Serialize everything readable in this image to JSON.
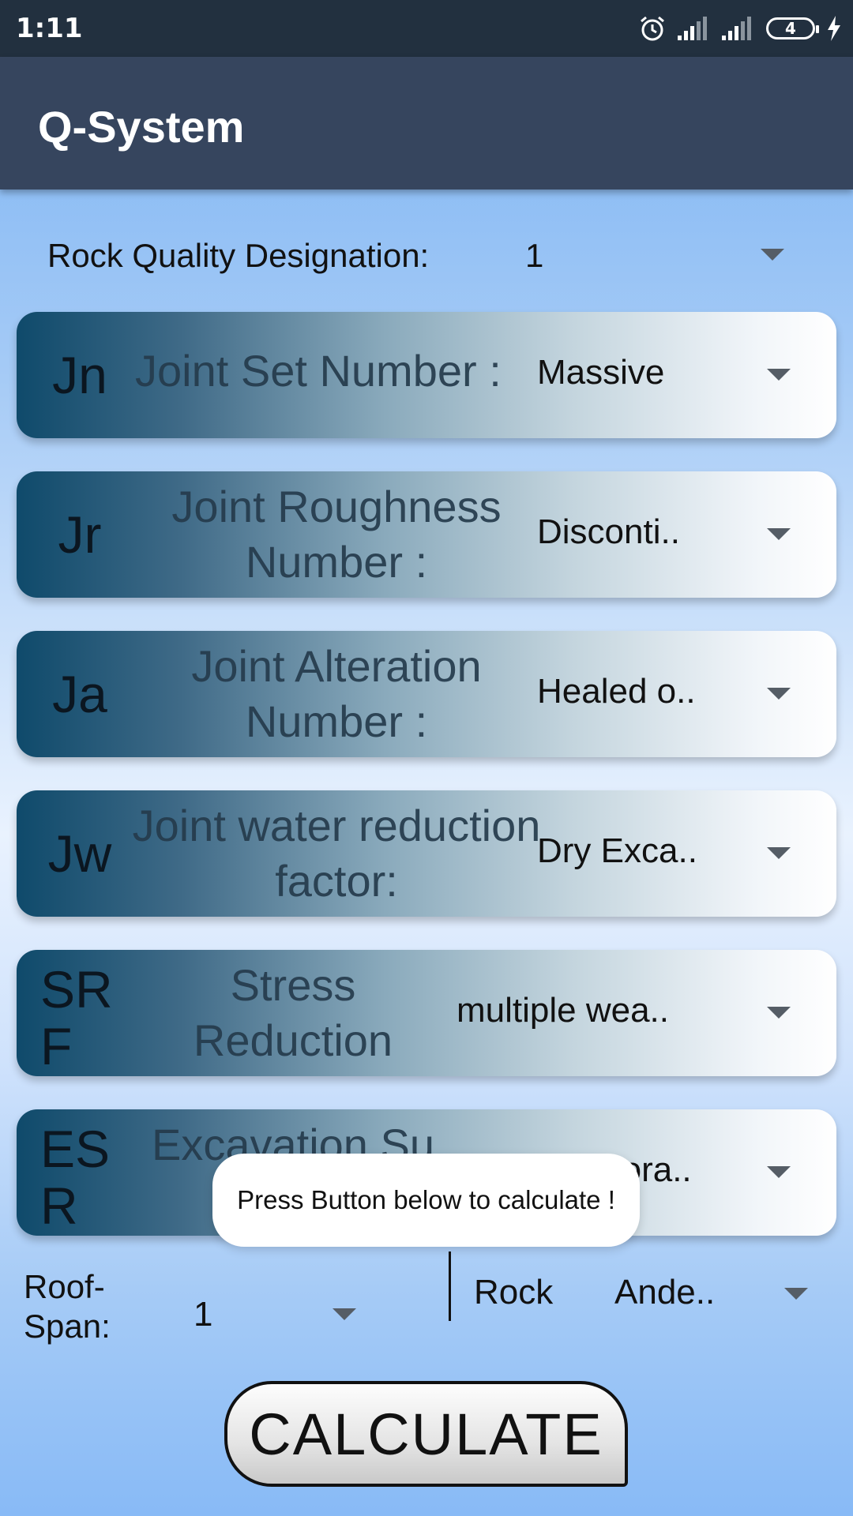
{
  "status": {
    "time": "1:11",
    "battery": "4"
  },
  "app": {
    "title": "Q-System"
  },
  "rqd": {
    "label": "Rock Quality Designation:",
    "value": "1"
  },
  "cards": [
    {
      "abbr": "Jn",
      "label": "Joint Set Number :",
      "value": "Massive"
    },
    {
      "abbr": "Jr",
      "label": "Joint Roughness Number :",
      "value": "Disconti.."
    },
    {
      "abbr": "Ja",
      "label": "Joint Alteration Number :",
      "value": "Healed o.."
    },
    {
      "abbr": "Jw",
      "label": "Joint water reduction factor:",
      "value": "Dry Exca.."
    },
    {
      "abbr": "SRF",
      "label": "Stress Reduction",
      "value": "multiple wea.."
    },
    {
      "abbr": "ESR",
      "label": "Excavation Su",
      "value": "Tempora.."
    }
  ],
  "toast": {
    "text": "Press Button below to calculate !"
  },
  "roof": {
    "label": "Roof-Span:",
    "value": "1"
  },
  "rock": {
    "label": "Rock",
    "value": "Ande.."
  },
  "calculate": {
    "label": "CALCULATE"
  }
}
